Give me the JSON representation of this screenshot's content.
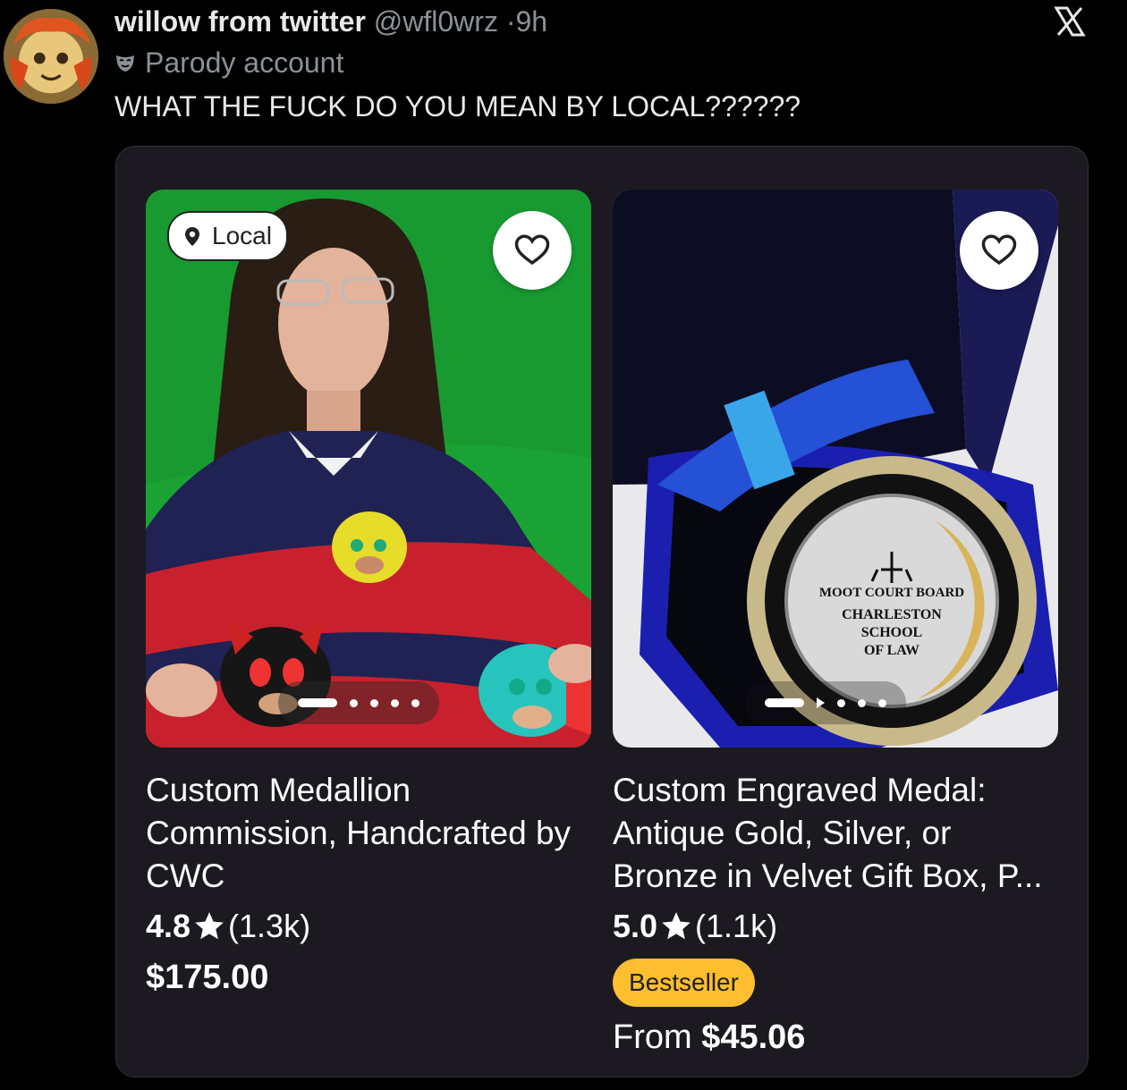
{
  "tweet": {
    "display_name": "willow from twitter",
    "handle": "@wfl0wrz",
    "separator": "·",
    "time": "9h",
    "parody_label": "Parody account",
    "text": "WHAT THE FUCK DO YOU MEAN BY LOCAL??????",
    "logo_icon": "x-logo-icon",
    "mask_icon": "parody-mask-icon"
  },
  "listings": [
    {
      "badge": "Local",
      "title": "Custom Medallion Commission, Handcrafted by CWC",
      "rating": "4.8",
      "reviews": "(1.3k)",
      "price": "$175.00",
      "carousel_images": 5,
      "carousel_current": 1
    },
    {
      "title": "Custom Engraved Medal: Antique Gold, Silver, or Bronze in Velvet Gift Box, P...",
      "rating": "5.0",
      "reviews": "(1.1k)",
      "badge": "Bestseller",
      "price_prefix": "From",
      "price": "$45.06",
      "carousel_images": 5,
      "carousel_current": 1
    }
  ],
  "colors": {
    "background": "#000000",
    "card": "#1c1a20",
    "bestseller": "#fdbe30"
  }
}
